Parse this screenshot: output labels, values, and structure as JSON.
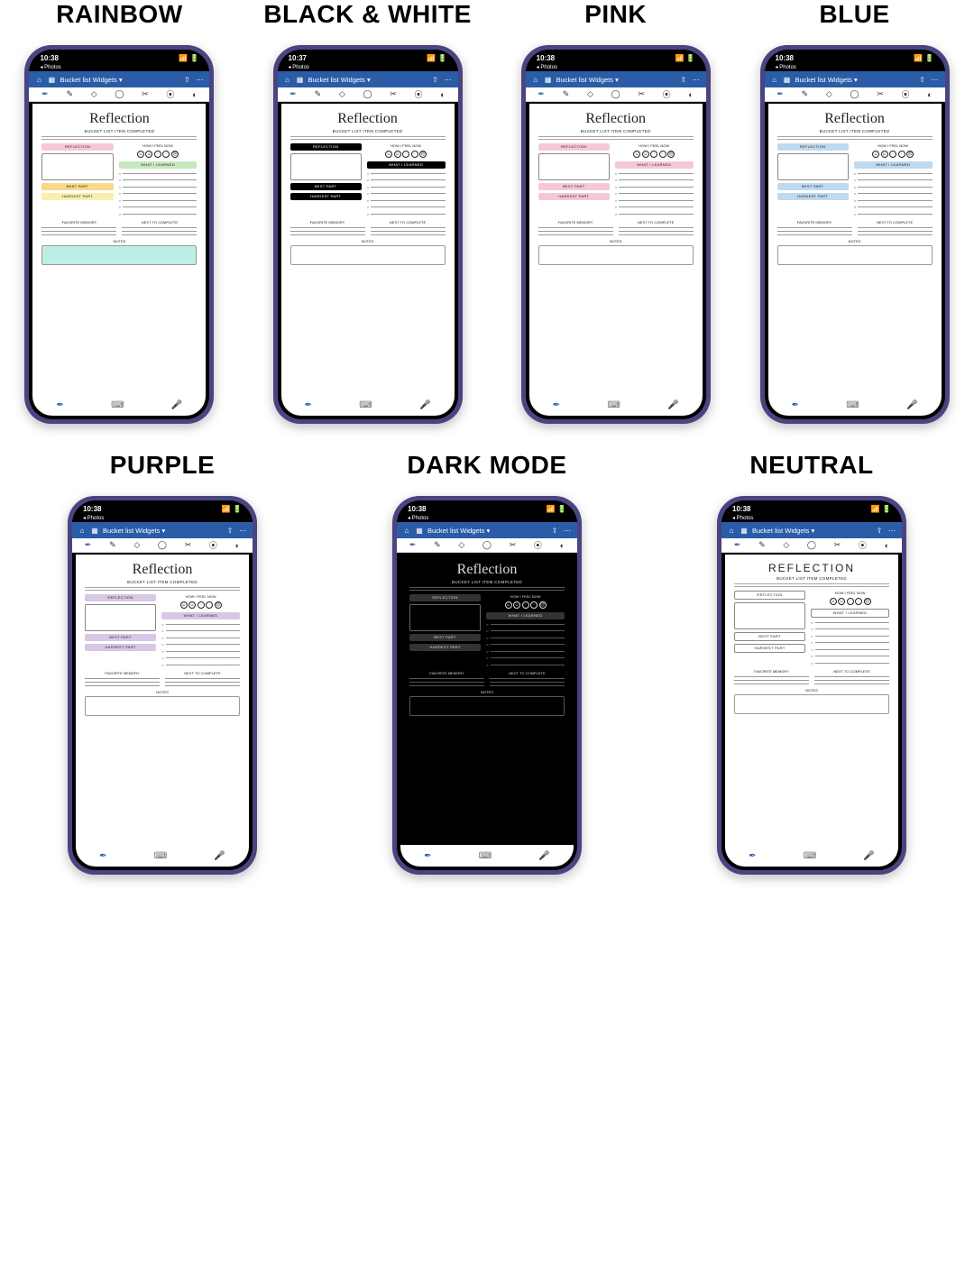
{
  "variants": [
    {
      "label": "RAINBOW",
      "time": "10:38",
      "scheme": "rainbow"
    },
    {
      "label": "BLACK & WHITE",
      "time": "10:37",
      "scheme": "bw"
    },
    {
      "label": "PINK",
      "time": "10:38",
      "scheme": "pink"
    },
    {
      "label": "BLUE",
      "time": "10:38",
      "scheme": "blue"
    },
    {
      "label": "PURPLE",
      "time": "10:38",
      "scheme": "purple"
    },
    {
      "label": "DARK MODE",
      "time": "10:38",
      "scheme": "dark"
    },
    {
      "label": "NEUTRAL",
      "time": "10:38",
      "scheme": "neutral"
    }
  ],
  "status_back": "◂ Photos",
  "header": {
    "title": "Bucket list Widgets ▾"
  },
  "page": {
    "title": "Reflection",
    "title_neutral": "REFLECTION",
    "subtitle": "BUCKET LIST ITEM COMPLETED",
    "reflection": "REFLECTION",
    "feel": "HOW I FEEL NOW",
    "learned": "WHAT I LEARNED",
    "best": "BEST PART",
    "hardest": "HARDEST PART",
    "favmem": "FAVORITE MEMORY",
    "next": "NEXT TO COMPLETE",
    "notes": "NOTES"
  },
  "colors": {
    "rainbow": {
      "reflection": "#f7c8d4",
      "learned": "#c7e8c1",
      "best": "#f8d88a",
      "hardest": "#f9efb0",
      "notes": "#bdeee5"
    },
    "bw": {
      "reflection": "#000",
      "learned": "#000",
      "best": "#000",
      "hardest": "#000",
      "notes": "transparent",
      "text": "#fff"
    },
    "pink": {
      "reflection": "#f6c8d6",
      "learned": "#f6c8d6",
      "best": "#f6c8d6",
      "hardest": "#f6c8d6",
      "notes": "transparent"
    },
    "blue": {
      "reflection": "#bfd9ee",
      "learned": "#bfd9ee",
      "best": "#bfd9ee",
      "hardest": "#bfd9ee",
      "notes": "transparent"
    },
    "purple": {
      "reflection": "#d9c7e6",
      "learned": "#d9c7e6",
      "best": "#d9c7e6",
      "hardest": "#d9c7e6",
      "notes": "transparent"
    },
    "dark": {
      "reflection": "#333",
      "learned": "#333",
      "best": "#333",
      "hardest": "#333",
      "notes": "transparent",
      "text": "#ddd"
    },
    "neutral": {
      "reflection": "transparent",
      "learned": "transparent",
      "best": "transparent",
      "hardest": "transparent",
      "notes": "transparent",
      "border": "1"
    }
  }
}
